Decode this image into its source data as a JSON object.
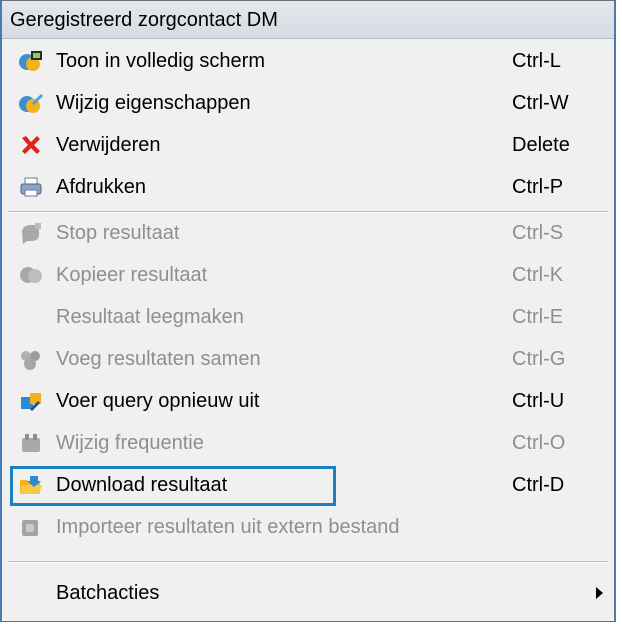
{
  "menu": {
    "title": "Geregistreerd zorgcontact DM",
    "items": [
      {
        "label": "Toon in volledig scherm",
        "shortcut": "Ctrl-L",
        "icon": "fullscreen-icon",
        "enabled": true
      },
      {
        "label": "Wijzig eigenschappen",
        "shortcut": "Ctrl-W",
        "icon": "edit-properties-icon",
        "enabled": true
      },
      {
        "label": "Verwijderen",
        "shortcut": "Delete",
        "icon": "delete-x-icon",
        "enabled": true
      },
      {
        "label": "Afdrukken",
        "shortcut": "Ctrl-P",
        "icon": "printer-icon",
        "enabled": true
      },
      {
        "label": "Stop resultaat",
        "shortcut": "Ctrl-S",
        "icon": "stop-result-icon",
        "enabled": false
      },
      {
        "label": "Kopieer resultaat",
        "shortcut": "Ctrl-K",
        "icon": "copy-result-icon",
        "enabled": false
      },
      {
        "label": "Resultaat leegmaken",
        "shortcut": "Ctrl-E",
        "icon": "",
        "enabled": false
      },
      {
        "label": "Voeg resultaten samen",
        "shortcut": "Ctrl-G",
        "icon": "merge-results-icon",
        "enabled": false
      },
      {
        "label": "Voer query opnieuw uit",
        "shortcut": "Ctrl-U",
        "icon": "rerun-query-icon",
        "enabled": true
      },
      {
        "label": "Wijzig frequentie",
        "shortcut": "Ctrl-O",
        "icon": "frequency-icon",
        "enabled": false
      },
      {
        "label": "Download resultaat",
        "shortcut": "Ctrl-D",
        "icon": "download-folder-icon",
        "enabled": true,
        "highlighted": true
      },
      {
        "label": "Importeer resultaten uit extern bestand",
        "shortcut": "",
        "icon": "import-icon",
        "enabled": false
      },
      {
        "label": "Batchacties",
        "shortcut": "",
        "icon": "",
        "enabled": true,
        "submenu": true
      }
    ]
  },
  "colors": {
    "highlight_border": "#1b7fc1",
    "disabled_text": "#8f8f8f"
  }
}
